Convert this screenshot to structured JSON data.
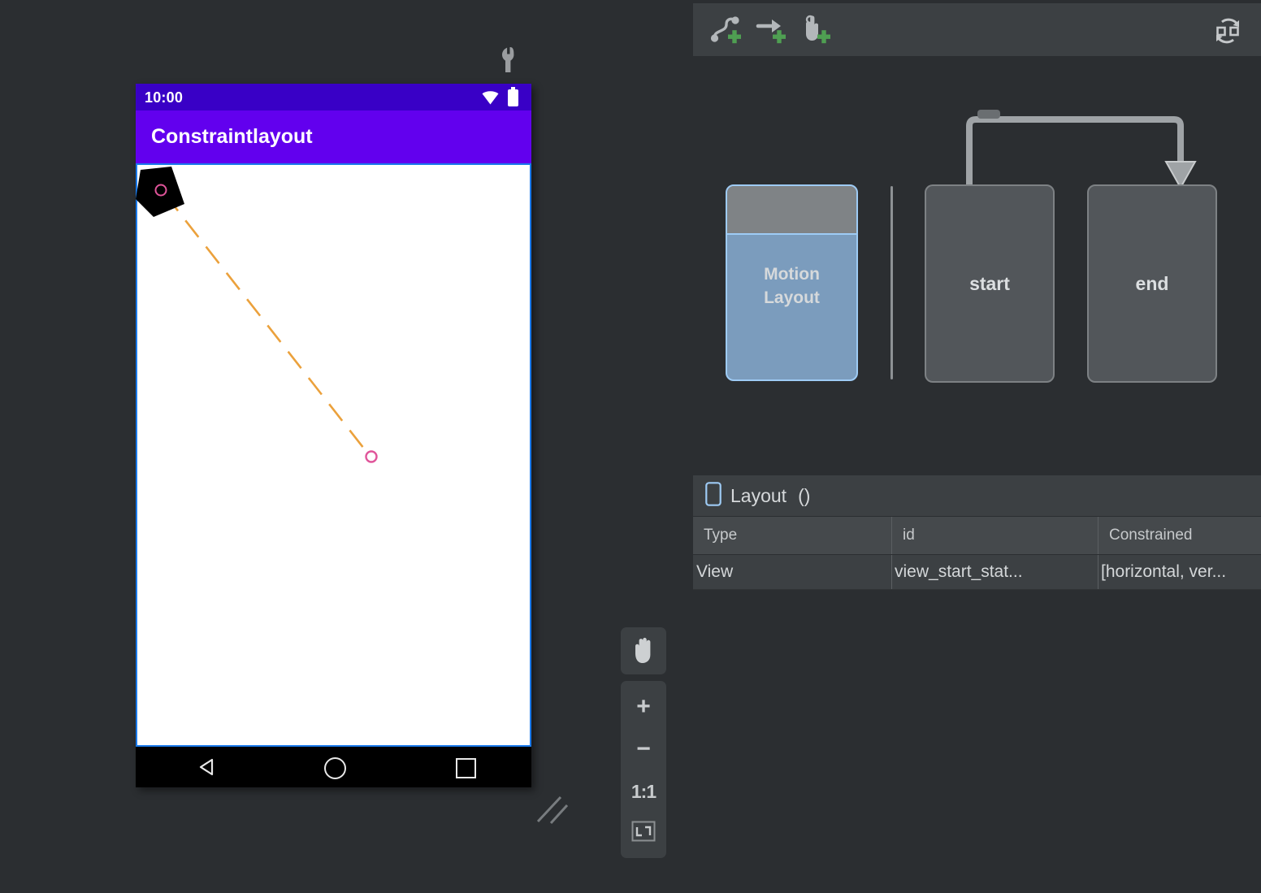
{
  "design_surface": {
    "tools_icon": "wrench-icon",
    "device": {
      "status_bar": {
        "time": "10:00",
        "wifi_icon": "wifi-icon",
        "battery_icon": "battery-icon"
      },
      "app_bar": {
        "title": "Constraintlayout"
      },
      "nav_bar": {
        "back_icon": "triangle-back-icon",
        "home_icon": "circle-home-icon",
        "recents_icon": "square-recents-icon"
      },
      "motion_path": {
        "start_marker": "start-keyframe-marker",
        "end_marker": "end-keyframe-marker",
        "path_color": "#eba13c",
        "widget_color": "#000000",
        "selection_color": "#1a7aeb"
      }
    },
    "zoom_controls": {
      "pan_label": "pan-tool",
      "zoom_in_label": "+",
      "zoom_out_label": "−",
      "zoom_actual_label": "1:1",
      "zoom_fit_label": "fit-to-screen"
    },
    "resize_grip": "resize-grip"
  },
  "motion_editor": {
    "toolbar": {
      "add_transition_label": "add-transition",
      "add_constraintset_label": "add-constraintset",
      "add_onclick_label": "add-onclick",
      "convert_label": "convert-to-motionlayout"
    },
    "canvas": {
      "motionlayout_card": {
        "label": "Motion\nLayout"
      },
      "states": [
        {
          "label": "start"
        },
        {
          "label": "end"
        }
      ],
      "transition": {
        "from": "start",
        "to": "end"
      }
    },
    "layout_panel": {
      "icon": "phone-icon",
      "title": "Layout",
      "parenthetical": "()",
      "columns": [
        "Type",
        "id",
        "Constrained"
      ],
      "rows": [
        [
          "View",
          "view_start_stat...",
          "[horizontal, ver..."
        ]
      ]
    }
  },
  "colors": {
    "background": "#2b2e31",
    "panel": "#3c4043",
    "accent_purple": "#6200ee",
    "status_purple": "#3900c6",
    "selection_blue": "#1a7aeb",
    "card_blue": "#7b9cbd",
    "card_border": "#9ecbf5",
    "state_card": "#52565a",
    "path_orange": "#eba13c",
    "marker_pink": "#e0559a",
    "add_green": "#4f9f52"
  }
}
